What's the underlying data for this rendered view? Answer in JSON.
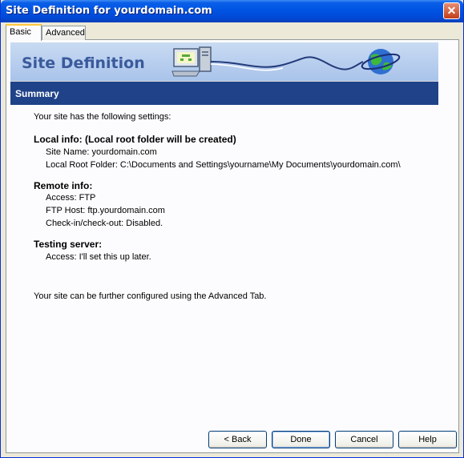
{
  "window": {
    "title": "Site Definition for yourdomain.com",
    "close_label": "✕"
  },
  "tabs": [
    {
      "label": "Basic",
      "active": true
    },
    {
      "label": "Advanced",
      "active": false
    }
  ],
  "banner": {
    "title": "Site Definition"
  },
  "section": {
    "title": "Summary"
  },
  "summary": {
    "intro": "Your site has the following settings:",
    "local": {
      "heading": "Local info: (Local root folder will be created)",
      "site_name": "Site Name: yourdomain.com",
      "root_folder": "Local Root Folder: C:\\Documents and Settings\\yourname\\My Documents\\yourdomain.com\\"
    },
    "remote": {
      "heading": "Remote info:",
      "access": "Access: FTP",
      "ftp_host": "FTP Host: ftp.yourdomain.com",
      "checkin": "Check-in/check-out: Disabled."
    },
    "testing": {
      "heading": "Testing server:",
      "access": "Access: I'll set this up later."
    },
    "footer": "Your site can be further configured using the Advanced Tab."
  },
  "buttons": {
    "back": "< Back",
    "done": "Done",
    "cancel": "Cancel",
    "help": "Help"
  },
  "colors": {
    "title_bar": "#0054e3",
    "section_bar": "#1f4288",
    "banner": "#b6cdef",
    "dialog_bg": "#ece9d8"
  },
  "icons": {
    "computer": "computer-icon",
    "globe": "globe-icon",
    "close": "close-icon"
  }
}
